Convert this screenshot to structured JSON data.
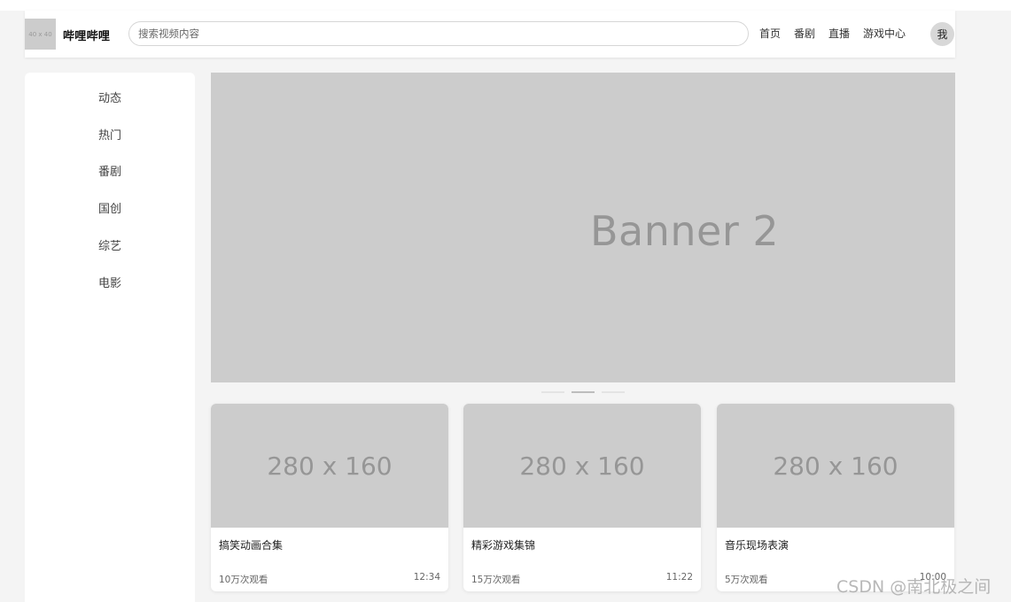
{
  "header": {
    "logo_placeholder": "40 x 40",
    "site_name": "哔哩哔哩",
    "search_placeholder": "搜索视频内容",
    "nav": [
      "首页",
      "番剧",
      "直播",
      "游戏中心"
    ],
    "avatar_text": "我"
  },
  "sidebar": {
    "items": [
      "动态",
      "热门",
      "番剧",
      "国创",
      "综艺",
      "电影"
    ]
  },
  "banner": {
    "text": "Banner 2",
    "dot_count": 3,
    "active_index": 1
  },
  "videos": [
    {
      "thumb": "280 x 160",
      "title": "搞笑动画合集",
      "views": "10万次观看",
      "duration": "12:34"
    },
    {
      "thumb": "280 x 160",
      "title": "精彩游戏集锦",
      "views": "15万次观看",
      "duration": "11:22"
    },
    {
      "thumb": "280 x 160",
      "title": "音乐现场表演",
      "views": "5万次观看",
      "duration": "10:00"
    }
  ],
  "watermark": "CSDN @南北极之间",
  "colors": {
    "page_bg": "#f4f4f4",
    "placeholder_gray": "#cccccc",
    "placeholder_text": "#969696"
  }
}
